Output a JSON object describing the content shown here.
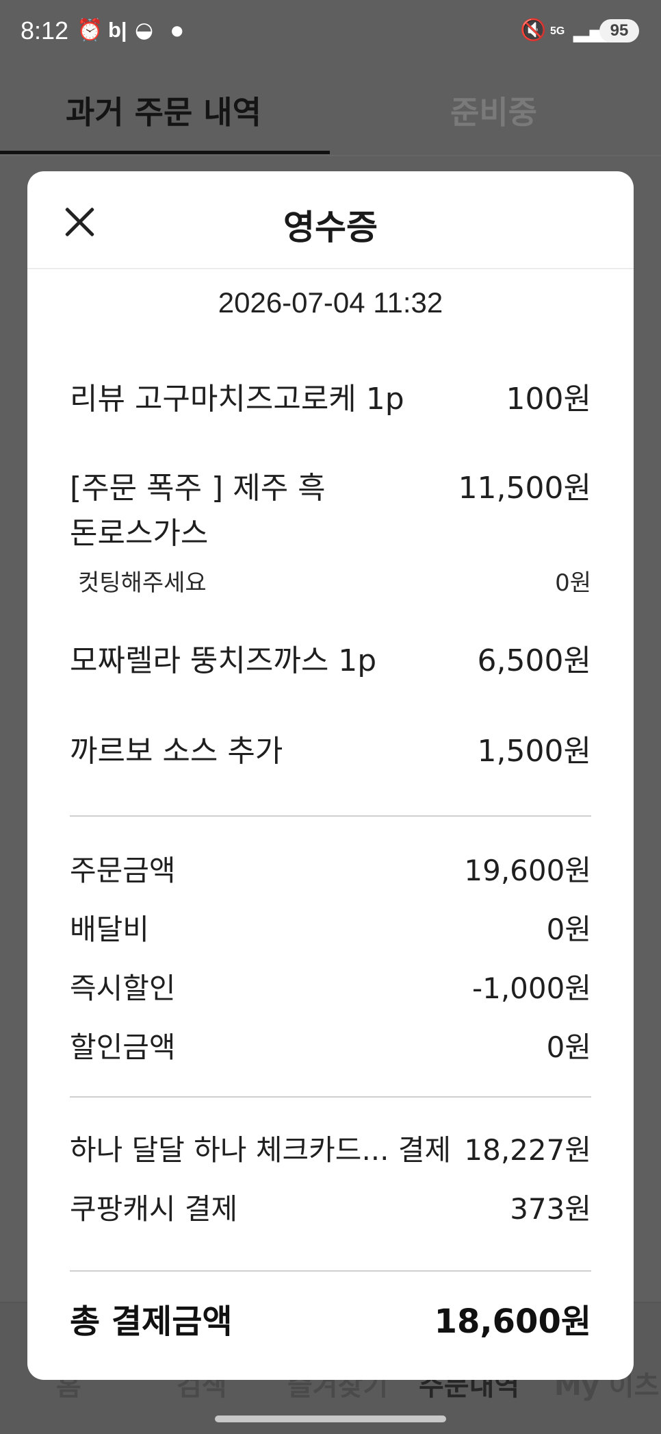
{
  "status_bar": {
    "time": "8:12",
    "left_icons": [
      "alarm-icon",
      "b-app-icon",
      "pokeball-icon",
      "dot-icon"
    ],
    "right_icons": [
      "mute-icon",
      "5g-icon",
      "signal-icon"
    ],
    "battery": "95"
  },
  "tabs": [
    {
      "label": "과거 주문 내역",
      "active": true
    },
    {
      "label": "준비중",
      "active": false
    }
  ],
  "bottom_nav": [
    "홈",
    "검색",
    "즐겨찾기",
    "주문내역",
    "My 이츠"
  ],
  "receipt": {
    "title": "영수증",
    "datetime": "2026-07-04 11:32",
    "items": [
      {
        "name": "리뷰 고구마치즈고로케 1p",
        "price": "100원"
      },
      {
        "name": "[주문 폭주 ] 제주 흑돈로스가스",
        "price": "11,500원"
      },
      {
        "name": "모짜렐라 뚱치즈까스 1p",
        "price": "6,500원"
      },
      {
        "name": "까르보 소스 추가",
        "price": "1,500원"
      }
    ],
    "option": {
      "name": "컷팅해주세요",
      "price": "0원"
    },
    "summary": [
      {
        "label": "주문금액",
        "value": "19,600원"
      },
      {
        "label": "배달비",
        "value": "0원"
      },
      {
        "label": "즉시할인",
        "value": "-1,000원"
      },
      {
        "label": "할인금액",
        "value": "0원"
      }
    ],
    "payments": [
      {
        "label": "하나 달달 하나 체크카드... 결제",
        "value": "18,227원"
      },
      {
        "label": "쿠팡캐시 결제",
        "value": "373원"
      }
    ],
    "total": {
      "label": "총 결제금액",
      "value": "18,600원"
    }
  },
  "colors": {
    "overlay": "#5f5f5f",
    "modal": "#ffffff",
    "text": "#1f1f1f"
  }
}
